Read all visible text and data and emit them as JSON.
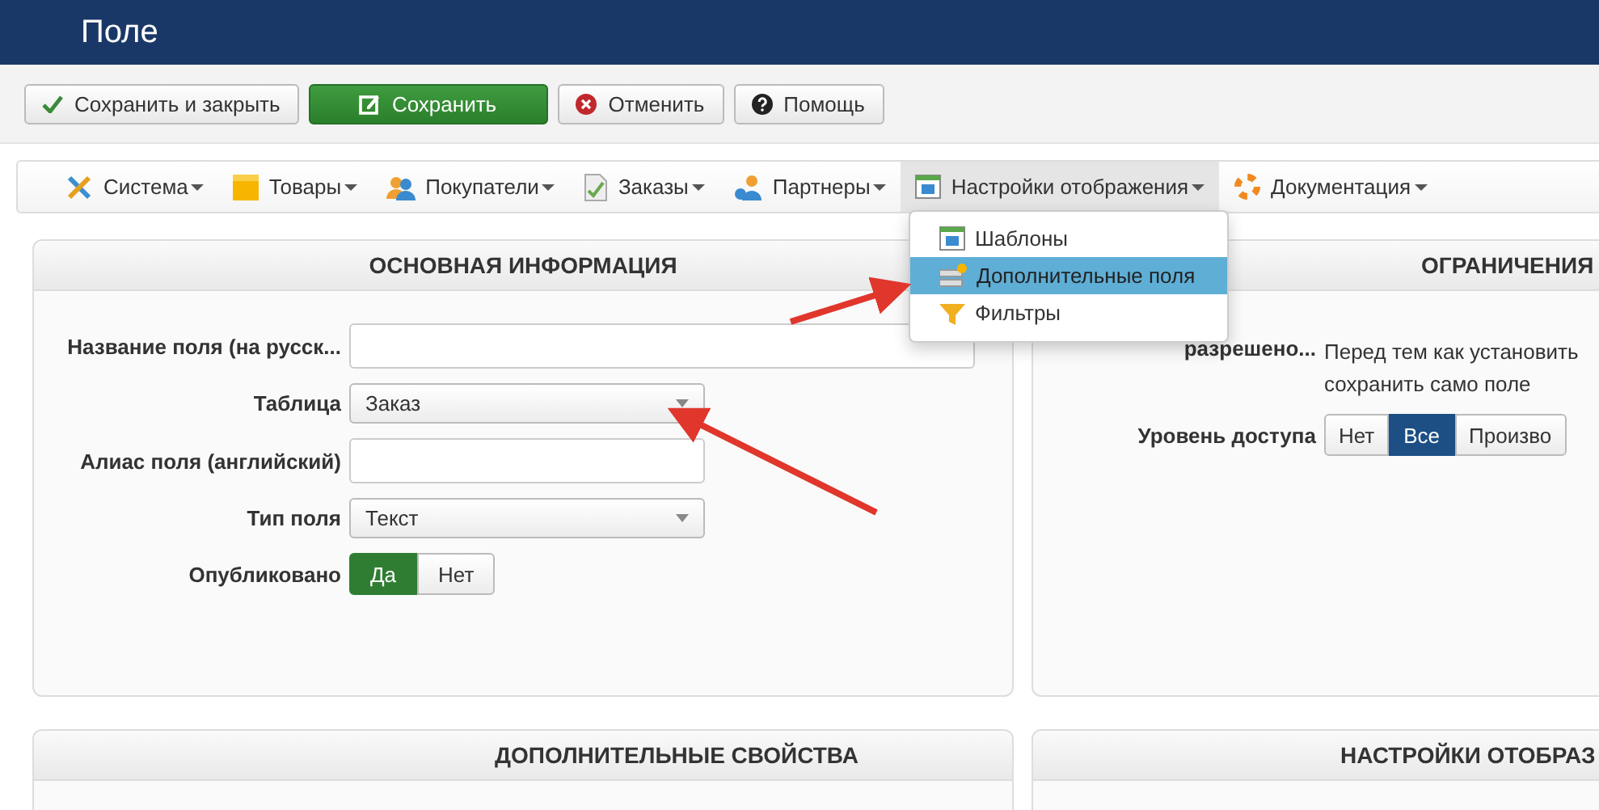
{
  "header": {
    "title": "Поле"
  },
  "toolbar": [
    {
      "label": "Сохранить и закрыть",
      "kind": "check"
    },
    {
      "label": "Сохранить",
      "kind": "primary"
    },
    {
      "label": "Отменить",
      "kind": "cancel"
    },
    {
      "label": "Помощь",
      "kind": "help"
    }
  ],
  "menu": [
    {
      "label": "Система",
      "selected": false
    },
    {
      "label": "Товары",
      "selected": false
    },
    {
      "label": "Покупатели",
      "selected": false
    },
    {
      "label": "Заказы",
      "selected": false
    },
    {
      "label": "Партнеры",
      "selected": false
    },
    {
      "label": "Настройки отображения",
      "selected": true,
      "expanded": true
    },
    {
      "label": "Документация",
      "selected": false
    }
  ],
  "dropdown": [
    {
      "label": "Шаблоны",
      "selected": false
    },
    {
      "label": "Дополнительные поля",
      "selected": true
    },
    {
      "label": "Фильтры",
      "selected": false
    }
  ],
  "main_panel": {
    "title": "ОСНОВНАЯ ИНФОРМАЦИЯ",
    "fields": [
      {
        "kind": "text",
        "label": "Название поля (на русск...",
        "wide": true
      },
      {
        "kind": "select",
        "label": "Таблица",
        "value": "Заказ"
      },
      {
        "kind": "text",
        "label": "Алиас поля (английский)"
      },
      {
        "kind": "select",
        "label": "Тип поля",
        "value": "Текст"
      },
      {
        "kind": "switch",
        "label": "Опубликовано",
        "options": [
          {
            "label": "Да",
            "selected": true
          },
          {
            "label": "Нет",
            "selected": false
          }
        ]
      }
    ]
  },
  "restrictions_panel": {
    "title": "ОГРАНИЧЕНИЯ",
    "fields": [
      {
        "kind": "note",
        "label": "разрешено...",
        "lines": [
          "Перед тем как установить",
          "сохранить само поле"
        ]
      },
      {
        "kind": "segmented",
        "label": "Уровень доступа",
        "options": [
          {
            "label": "Нет",
            "selected": false
          },
          {
            "label": "Все",
            "selected": true
          },
          {
            "label": "Произво",
            "selected": false
          }
        ]
      }
    ]
  },
  "bottom_panels": [
    {
      "title": "ДОПОЛНИТЕЛЬНЫЕ СВОЙСТВА"
    },
    {
      "title": "НАСТРОЙКИ ОТОБРАЗ"
    }
  ]
}
